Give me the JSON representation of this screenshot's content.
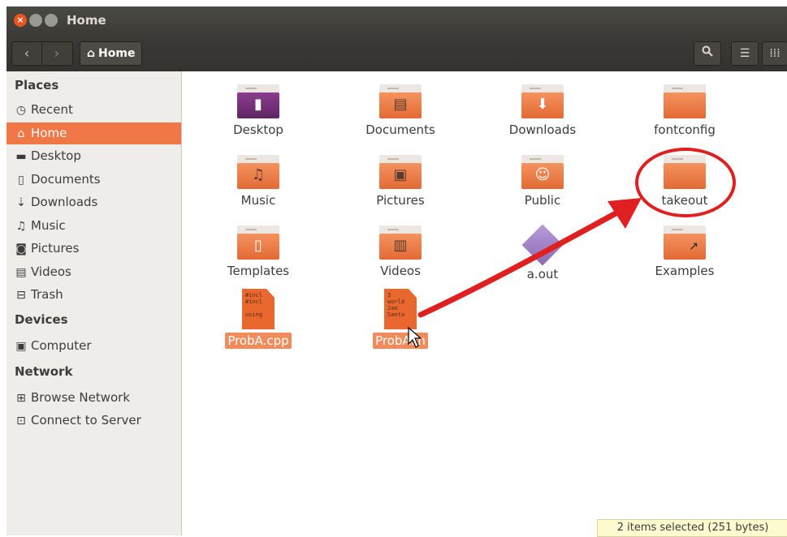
{
  "window": {
    "title": "Home"
  },
  "toolbar": {
    "back_icon": "chevron-left",
    "forward_icon": "chevron-right",
    "path_label": "Home",
    "path_icon": "home",
    "search_icon": "search",
    "list_icon": "list",
    "grid_icon": "grid"
  },
  "sidebar": {
    "places_heading": "Places",
    "places": [
      {
        "label": "Recent",
        "icon": "clock"
      },
      {
        "label": "Home",
        "icon": "home",
        "active": true
      },
      {
        "label": "Desktop",
        "icon": "folder"
      },
      {
        "label": "Documents",
        "icon": "document"
      },
      {
        "label": "Downloads",
        "icon": "download"
      },
      {
        "label": "Music",
        "icon": "music"
      },
      {
        "label": "Pictures",
        "icon": "camera"
      },
      {
        "label": "Videos",
        "icon": "film"
      },
      {
        "label": "Trash",
        "icon": "trash"
      }
    ],
    "devices_heading": "Devices",
    "devices": [
      {
        "label": "Computer",
        "icon": "drive"
      }
    ],
    "network_heading": "Network",
    "network": [
      {
        "label": "Browse Network",
        "icon": "network"
      },
      {
        "label": "Connect to Server",
        "icon": "server"
      }
    ]
  },
  "files": [
    {
      "name": "Desktop",
      "kind": "folder-desktop"
    },
    {
      "name": "Documents",
      "kind": "folder-documents"
    },
    {
      "name": "Downloads",
      "kind": "folder-downloads"
    },
    {
      "name": "fontconfig",
      "kind": "folder"
    },
    {
      "name": "Music",
      "kind": "folder-music"
    },
    {
      "name": "Pictures",
      "kind": "folder-pictures"
    },
    {
      "name": "Public",
      "kind": "folder-public"
    },
    {
      "name": "takeout",
      "kind": "folder"
    },
    {
      "name": "Templates",
      "kind": "folder-templates"
    },
    {
      "name": "Videos",
      "kind": "folder-videos"
    },
    {
      "name": "a.out",
      "kind": "executable"
    },
    {
      "name": "Examples",
      "kind": "folder-link"
    },
    {
      "name": "ProbA.cpp",
      "kind": "text-file",
      "selected": true,
      "preview": "#incl\n#incl\n\nusing"
    },
    {
      "name": "ProbA.in",
      "kind": "text-file",
      "selected": true,
      "preview": "3\nworld\nJan\nSanta"
    }
  ],
  "status": {
    "text": "2 items selected (251 bytes)"
  },
  "colors": {
    "accent": "#f07746",
    "annotation": "#e02020"
  }
}
